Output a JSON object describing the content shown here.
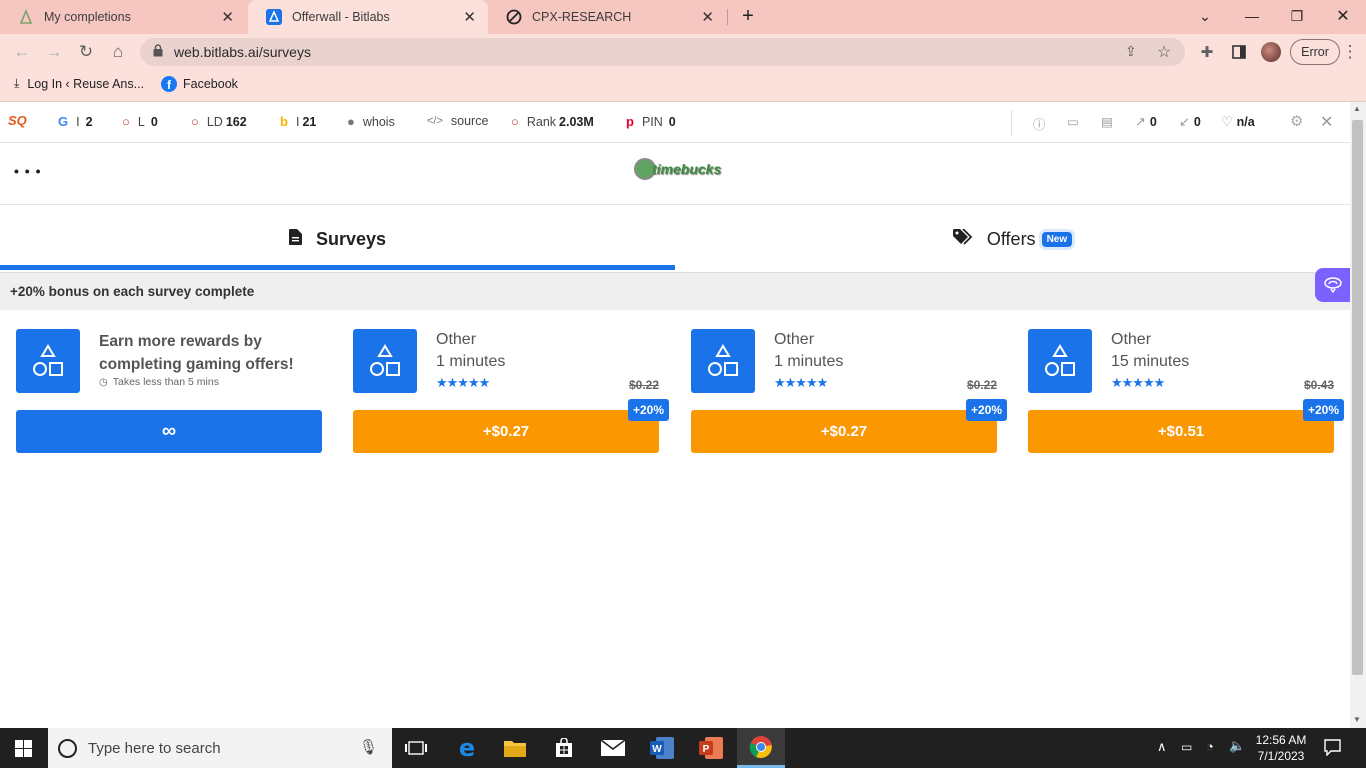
{
  "browser": {
    "tabs": [
      {
        "title": "My completions"
      },
      {
        "title": "Offerwall - Bitlabs"
      },
      {
        "title": "CPX-RESEARCH"
      }
    ],
    "url": "web.bitlabs.ai/surveys",
    "profile_status": "Error",
    "bookmarks": [
      {
        "label": "Log In ‹ Reuse Ans..."
      },
      {
        "label": "Facebook"
      }
    ]
  },
  "seo_bar": {
    "google": {
      "prefix": "I",
      "value": "2"
    },
    "links": {
      "prefix": "L",
      "value": "0"
    },
    "ld": {
      "prefix": "LD",
      "value": "162"
    },
    "bing": {
      "prefix": "I",
      "value": "21"
    },
    "whois": "whois",
    "source": "source",
    "rank": {
      "prefix": "Rank",
      "value": "2.03M"
    },
    "pin": {
      "prefix": "PIN",
      "value": "0"
    },
    "ext_links": "0",
    "int_links": "0",
    "health": "n/a"
  },
  "app": {
    "menu": "• • •",
    "logo_text": "timebucks",
    "tabs": {
      "surveys": "Surveys",
      "offers": "Offers",
      "offers_badge": "New"
    },
    "bonus_banner": "+20% bonus on each survey complete",
    "promo": {
      "title": "Earn more rewards by completing gaming offers!",
      "note": "Takes less than 5 mins",
      "button": "∞"
    },
    "surveys": [
      {
        "category": "Other",
        "duration": "1 minutes",
        "rating": 5,
        "old_price": "$0.22",
        "bonus": "+20%",
        "reward": "+$0.27"
      },
      {
        "category": "Other",
        "duration": "1 minutes",
        "rating": 5,
        "old_price": "$0.22",
        "bonus": "+20%",
        "reward": "+$0.27"
      },
      {
        "category": "Other",
        "duration": "15 minutes",
        "rating": 5,
        "old_price": "$0.43",
        "bonus": "+20%",
        "reward": "+$0.51"
      }
    ],
    "stars_text": "★★★★★"
  },
  "taskbar": {
    "search_placeholder": "Type here to search",
    "time": "12:56 AM",
    "date": "7/1/2023"
  },
  "colors": {
    "accent_blue": "#1a73e8",
    "reward_orange": "#fb9700",
    "tabbar_pink": "#f6c6c0"
  }
}
